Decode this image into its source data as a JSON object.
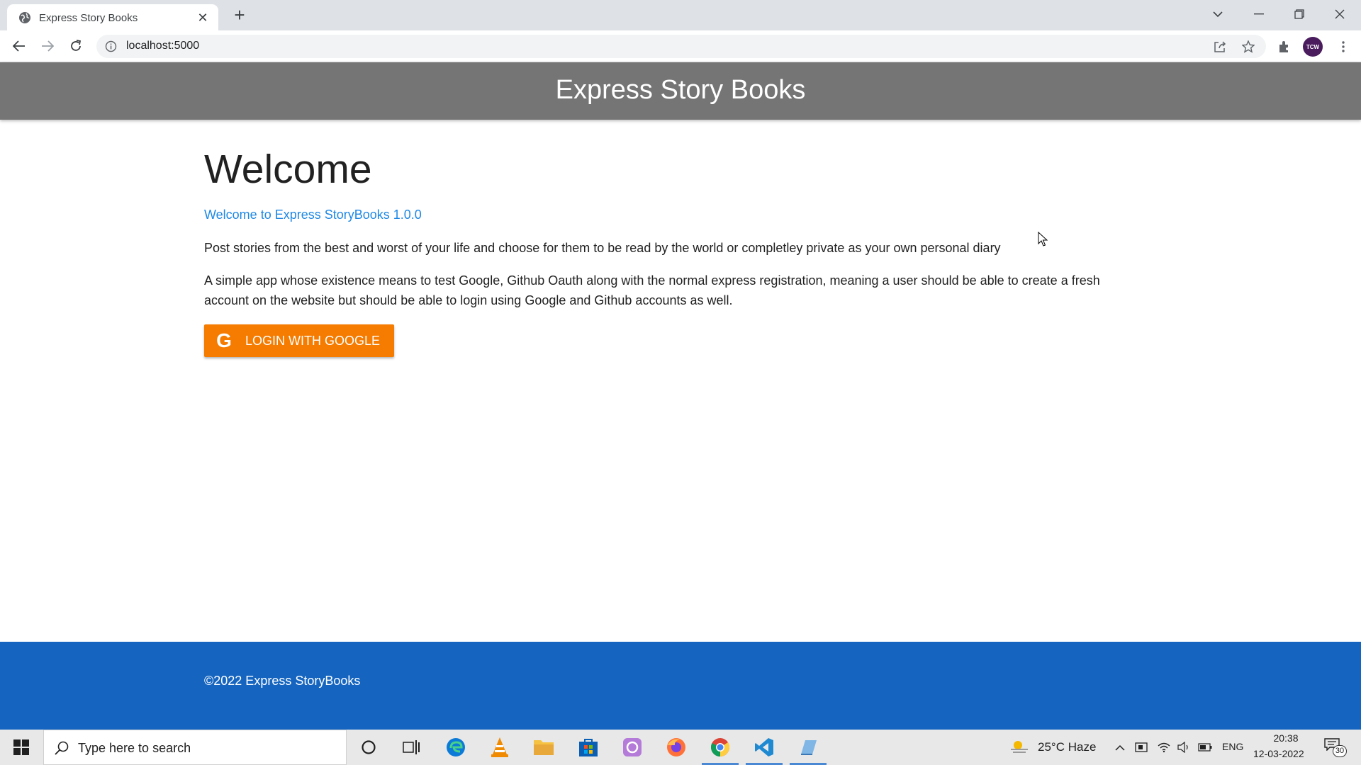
{
  "browser": {
    "tab_title": "Express Story Books",
    "url": "localhost:5000",
    "profile_initials": "TCW"
  },
  "site": {
    "brand": "Express Story Books",
    "heading": "Welcome",
    "subtitle": "Welcome to Express StoryBooks 1.0.0",
    "paragraph1": "Post stories from the best and worst of your life and choose for them to be read by the world or completley private as your own personal diary",
    "paragraph2": "A simple app whose existence means to test Google, Github Oauth along with the normal express registration, meaning a user should be able to create a fresh account on the website but should be able to login using Google and Github accounts as well.",
    "login_button": "LOGIN WITH GOOGLE",
    "login_icon_glyph": "G",
    "footer": "©2022 Express StoryBooks",
    "colors": {
      "header": "#757575",
      "footer": "#1565c0",
      "link": "#1e88e5",
      "button": "#f57c00"
    }
  },
  "taskbar": {
    "search_placeholder": "Type here to search",
    "weather": "25°C  Haze",
    "language": "ENG",
    "time": "20:38",
    "date": "12-03-2022",
    "notifications": "30"
  }
}
